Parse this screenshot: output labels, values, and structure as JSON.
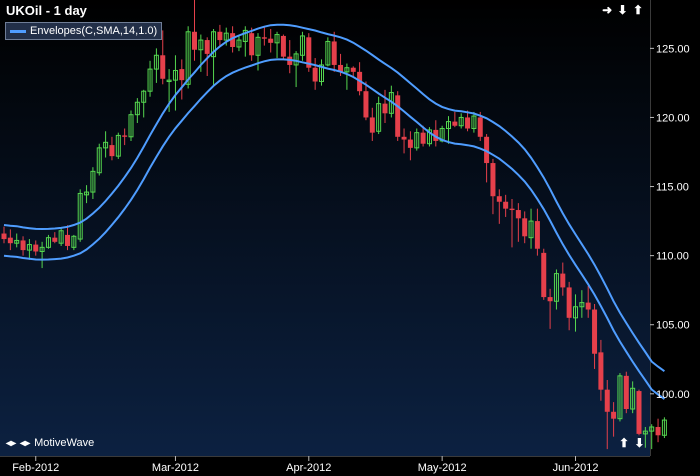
{
  "window": {
    "title": "UKOil - 1 day",
    "watermark": "MotiveWave"
  },
  "legend": {
    "label": "Envelopes(C,SMA,14,1.0)",
    "color": "#4f9dff"
  },
  "colors": {
    "background_top": "#000000",
    "background_bottom": "#0c2141",
    "up_candle": "#55d64f",
    "down_candle": "#e5404b",
    "envelope": "#4f9dff",
    "axis_text": "#ffffff"
  },
  "icons": {
    "top_right": [
      "expand-right-icon",
      "arrow-down-icon",
      "arrow-up-icon"
    ],
    "bottom_right": [
      "arrow-up-icon",
      "arrow-down-icon"
    ],
    "bottom_left": [
      "move-left-icon",
      "move-right-icon"
    ]
  },
  "chart_data": {
    "type": "candlestick",
    "title": "UKOil - 1 day",
    "ylim": [
      95.5,
      128.5
    ],
    "y_ticks": [
      "125.00",
      "120.00",
      "115.00",
      "110.00",
      "105.00",
      "100.00"
    ],
    "x_ticks": [
      "Feb-2012",
      "Mar-2012",
      "Apr-2012",
      "May-2012",
      "Jun-2012"
    ],
    "x_tick_index": [
      5,
      27,
      48,
      69,
      90
    ],
    "candles": [
      {
        "o": 111.6,
        "h": 112.1,
        "l": 110.9,
        "c": 111.2
      },
      {
        "o": 111.3,
        "h": 111.9,
        "l": 110.4,
        "c": 110.9
      },
      {
        "o": 110.9,
        "h": 111.6,
        "l": 110.6,
        "c": 111.1
      },
      {
        "o": 111.1,
        "h": 111.4,
        "l": 110.0,
        "c": 110.4
      },
      {
        "o": 110.4,
        "h": 111.2,
        "l": 109.7,
        "c": 110.8
      },
      {
        "o": 110.8,
        "h": 111.1,
        "l": 110.0,
        "c": 110.3
      },
      {
        "o": 110.3,
        "h": 111.0,
        "l": 109.1,
        "c": 110.6
      },
      {
        "o": 110.6,
        "h": 111.5,
        "l": 110.5,
        "c": 111.3
      },
      {
        "o": 111.3,
        "h": 111.7,
        "l": 110.9,
        "c": 111.0
      },
      {
        "o": 110.9,
        "h": 112.0,
        "l": 110.7,
        "c": 111.8
      },
      {
        "o": 111.5,
        "h": 112.2,
        "l": 110.4,
        "c": 110.7
      },
      {
        "o": 110.6,
        "h": 111.5,
        "l": 110.4,
        "c": 111.4
      },
      {
        "o": 111.2,
        "h": 114.8,
        "l": 111.0,
        "c": 114.5
      },
      {
        "o": 114.4,
        "h": 115.1,
        "l": 113.8,
        "c": 114.6
      },
      {
        "o": 114.6,
        "h": 116.4,
        "l": 114.1,
        "c": 116.1
      },
      {
        "o": 116.0,
        "h": 118.1,
        "l": 115.8,
        "c": 117.8
      },
      {
        "o": 117.8,
        "h": 119.0,
        "l": 117.1,
        "c": 118.2
      },
      {
        "o": 118.0,
        "h": 118.6,
        "l": 116.9,
        "c": 117.2
      },
      {
        "o": 117.2,
        "h": 118.9,
        "l": 117.0,
        "c": 118.7
      },
      {
        "o": 118.7,
        "h": 119.2,
        "l": 118.0,
        "c": 118.6
      },
      {
        "o": 118.6,
        "h": 120.5,
        "l": 118.3,
        "c": 120.2
      },
      {
        "o": 120.2,
        "h": 121.4,
        "l": 119.6,
        "c": 121.1
      },
      {
        "o": 121.1,
        "h": 122.0,
        "l": 120.0,
        "c": 121.9
      },
      {
        "o": 121.9,
        "h": 124.1,
        "l": 121.5,
        "c": 123.5
      },
      {
        "o": 123.5,
        "h": 125.0,
        "l": 122.5,
        "c": 124.5
      },
      {
        "o": 124.5,
        "h": 126.3,
        "l": 122.4,
        "c": 122.8
      },
      {
        "o": 122.6,
        "h": 123.5,
        "l": 120.4,
        "c": 122.7
      },
      {
        "o": 122.7,
        "h": 124.5,
        "l": 120.5,
        "c": 123.4
      },
      {
        "o": 123.5,
        "h": 124.2,
        "l": 121.3,
        "c": 122.7
      },
      {
        "o": 122.4,
        "h": 126.6,
        "l": 122.1,
        "c": 126.2
      },
      {
        "o": 126.2,
        "h": 128.5,
        "l": 124.1,
        "c": 124.9
      },
      {
        "o": 124.9,
        "h": 126.0,
        "l": 123.3,
        "c": 125.6
      },
      {
        "o": 125.6,
        "h": 125.8,
        "l": 123.0,
        "c": 124.6
      },
      {
        "o": 124.4,
        "h": 126.4,
        "l": 122.3,
        "c": 126.2
      },
      {
        "o": 126.2,
        "h": 126.7,
        "l": 125.1,
        "c": 125.6
      },
      {
        "o": 125.6,
        "h": 126.5,
        "l": 125.2,
        "c": 126.1
      },
      {
        "o": 126.1,
        "h": 126.6,
        "l": 124.7,
        "c": 125.1
      },
      {
        "o": 125.1,
        "h": 125.9,
        "l": 124.8,
        "c": 125.6
      },
      {
        "o": 125.5,
        "h": 126.6,
        "l": 124.4,
        "c": 126.3
      },
      {
        "o": 126.1,
        "h": 126.5,
        "l": 124.1,
        "c": 124.5
      },
      {
        "o": 124.5,
        "h": 126.1,
        "l": 123.4,
        "c": 125.8
      },
      {
        "o": 125.8,
        "h": 126.6,
        "l": 125.2,
        "c": 125.7
      },
      {
        "o": 125.7,
        "h": 126.4,
        "l": 124.7,
        "c": 125.4
      },
      {
        "o": 125.4,
        "h": 126.2,
        "l": 124.3,
        "c": 126.0
      },
      {
        "o": 125.9,
        "h": 126.0,
        "l": 124.2,
        "c": 124.4
      },
      {
        "o": 124.4,
        "h": 125.6,
        "l": 123.2,
        "c": 123.8
      },
      {
        "o": 123.8,
        "h": 124.8,
        "l": 122.2,
        "c": 124.6
      },
      {
        "o": 124.5,
        "h": 126.2,
        "l": 124.1,
        "c": 125.9
      },
      {
        "o": 125.8,
        "h": 126.1,
        "l": 123.3,
        "c": 123.6
      },
      {
        "o": 123.6,
        "h": 124.3,
        "l": 122.0,
        "c": 122.6
      },
      {
        "o": 122.6,
        "h": 124.2,
        "l": 122.3,
        "c": 123.8
      },
      {
        "o": 123.8,
        "h": 125.8,
        "l": 123.7,
        "c": 125.5
      },
      {
        "o": 125.5,
        "h": 126.2,
        "l": 123.3,
        "c": 123.8
      },
      {
        "o": 123.8,
        "h": 124.6,
        "l": 123.0,
        "c": 123.3
      },
      {
        "o": 123.3,
        "h": 123.9,
        "l": 122.0,
        "c": 123.6
      },
      {
        "o": 123.6,
        "h": 123.7,
        "l": 122.9,
        "c": 123.3
      },
      {
        "o": 123.3,
        "h": 124.0,
        "l": 121.6,
        "c": 121.9
      },
      {
        "o": 121.9,
        "h": 122.6,
        "l": 119.8,
        "c": 120.0
      },
      {
        "o": 120.0,
        "h": 120.7,
        "l": 118.3,
        "c": 118.9
      },
      {
        "o": 119.0,
        "h": 121.5,
        "l": 118.8,
        "c": 121.0
      },
      {
        "o": 121.0,
        "h": 122.0,
        "l": 119.6,
        "c": 120.3
      },
      {
        "o": 120.3,
        "h": 122.3,
        "l": 120.0,
        "c": 121.8
      },
      {
        "o": 121.6,
        "h": 121.9,
        "l": 118.3,
        "c": 118.6
      },
      {
        "o": 118.6,
        "h": 119.2,
        "l": 117.4,
        "c": 118.4
      },
      {
        "o": 118.4,
        "h": 119.0,
        "l": 116.9,
        "c": 117.8
      },
      {
        "o": 117.8,
        "h": 119.2,
        "l": 117.6,
        "c": 118.9
      },
      {
        "o": 118.9,
        "h": 119.4,
        "l": 117.9,
        "c": 118.1
      },
      {
        "o": 118.1,
        "h": 119.3,
        "l": 117.9,
        "c": 119.1
      },
      {
        "o": 119.1,
        "h": 119.8,
        "l": 117.9,
        "c": 118.3
      },
      {
        "o": 118.3,
        "h": 119.4,
        "l": 118.2,
        "c": 119.2
      },
      {
        "o": 119.2,
        "h": 120.1,
        "l": 118.1,
        "c": 119.7
      },
      {
        "o": 119.7,
        "h": 120.4,
        "l": 119.3,
        "c": 119.4
      },
      {
        "o": 119.4,
        "h": 120.3,
        "l": 119.2,
        "c": 120.0
      },
      {
        "o": 120.0,
        "h": 120.5,
        "l": 119.0,
        "c": 119.2
      },
      {
        "o": 119.2,
        "h": 120.4,
        "l": 118.9,
        "c": 120.1
      },
      {
        "o": 120.0,
        "h": 120.4,
        "l": 118.3,
        "c": 118.6
      },
      {
        "o": 118.6,
        "h": 118.8,
        "l": 115.3,
        "c": 116.7
      },
      {
        "o": 116.7,
        "h": 117.0,
        "l": 113.0,
        "c": 114.3
      },
      {
        "o": 114.3,
        "h": 114.8,
        "l": 112.3,
        "c": 113.9
      },
      {
        "o": 113.9,
        "h": 114.4,
        "l": 112.8,
        "c": 113.4
      },
      {
        "o": 113.4,
        "h": 114.1,
        "l": 110.6,
        "c": 113.3
      },
      {
        "o": 113.3,
        "h": 113.8,
        "l": 111.0,
        "c": 112.7
      },
      {
        "o": 112.7,
        "h": 113.2,
        "l": 110.9,
        "c": 111.4
      },
      {
        "o": 111.3,
        "h": 113.4,
        "l": 110.5,
        "c": 112.5
      },
      {
        "o": 112.5,
        "h": 113.4,
        "l": 110.0,
        "c": 110.5
      },
      {
        "o": 110.2,
        "h": 110.5,
        "l": 106.8,
        "c": 107.0
      },
      {
        "o": 107.0,
        "h": 107.6,
        "l": 104.7,
        "c": 106.7
      },
      {
        "o": 106.7,
        "h": 109.0,
        "l": 106.1,
        "c": 108.7
      },
      {
        "o": 108.7,
        "h": 109.5,
        "l": 107.1,
        "c": 107.7
      },
      {
        "o": 107.7,
        "h": 108.1,
        "l": 104.6,
        "c": 105.5
      },
      {
        "o": 105.5,
        "h": 107.2,
        "l": 104.5,
        "c": 106.3
      },
      {
        "o": 106.3,
        "h": 107.5,
        "l": 105.5,
        "c": 106.6
      },
      {
        "o": 106.6,
        "h": 107.8,
        "l": 105.5,
        "c": 106.1
      },
      {
        "o": 106.1,
        "h": 106.5,
        "l": 101.8,
        "c": 102.9
      },
      {
        "o": 103.0,
        "h": 103.9,
        "l": 99.5,
        "c": 100.3
      },
      {
        "o": 100.3,
        "h": 101.0,
        "l": 96.0,
        "c": 98.7
      },
      {
        "o": 98.7,
        "h": 99.4,
        "l": 96.9,
        "c": 98.2
      },
      {
        "o": 98.2,
        "h": 101.5,
        "l": 98.0,
        "c": 101.3
      },
      {
        "o": 101.3,
        "h": 101.6,
        "l": 98.6,
        "c": 98.9
      },
      {
        "o": 98.9,
        "h": 100.9,
        "l": 98.6,
        "c": 100.4
      },
      {
        "o": 100.2,
        "h": 100.3,
        "l": 97.0,
        "c": 97.1
      },
      {
        "o": 97.1,
        "h": 97.6,
        "l": 96.1,
        "c": 97.3
      },
      {
        "o": 97.3,
        "h": 97.8,
        "l": 96.0,
        "c": 97.6
      },
      {
        "o": 97.6,
        "h": 98.2,
        "l": 96.5,
        "c": 97.0
      },
      {
        "o": 97.0,
        "h": 98.3,
        "l": 96.8,
        "c": 98.1
      }
    ]
  }
}
